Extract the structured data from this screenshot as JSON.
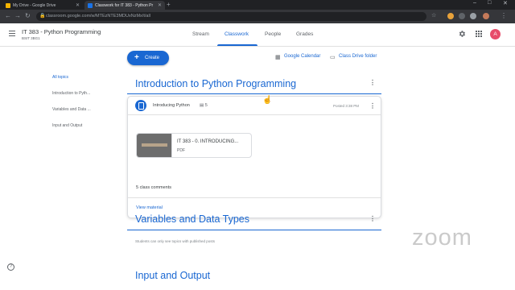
{
  "browser": {
    "tabs": [
      {
        "title": "My Drive - Google Drive",
        "active": false,
        "favicon_color": "#f6b400"
      },
      {
        "title": "Classwork for IT 383 - Python Pr",
        "active": true,
        "favicon_color": "#1a73e8"
      }
    ],
    "address": "classroom.google.com/w/MTEzNTE3MDUxNzMx/t/all",
    "newtab_label": "+",
    "win_min": "–",
    "win_max": "□",
    "win_close": "✕"
  },
  "header": {
    "class_title": "IT 383 - Python Programming",
    "class_section": "BSIT 3BG1",
    "tabs": [
      "Stream",
      "Classwork",
      "People",
      "Grades"
    ],
    "active_tab": "Classwork",
    "avatar_letter": "A"
  },
  "toolbar": {
    "create_label": "Create",
    "calendar_label": "Google Calendar",
    "drive_label": "Class Drive folder"
  },
  "topics": [
    "All topics",
    "Introduction to Pyth...",
    "Variables and Data ...",
    "Input and Output"
  ],
  "sections": [
    {
      "title": "Introduction to Python Programming"
    },
    {
      "title": "Variables and Data Types",
      "note": "Students can only see topics with published posts"
    },
    {
      "title": "Input and Output"
    }
  ],
  "material": {
    "title": "Introducing Python",
    "comment_count": "5",
    "posted": "Posted 3:38 PM",
    "attachment_title": "IT 383 - 0. INTRODUCING...",
    "attachment_type": "PDF",
    "class_comments": "5 class comments",
    "view_label": "View material"
  },
  "watermark": "zoom",
  "colors": {
    "accent": "#1967d2",
    "avatar": "#e74c6a"
  }
}
